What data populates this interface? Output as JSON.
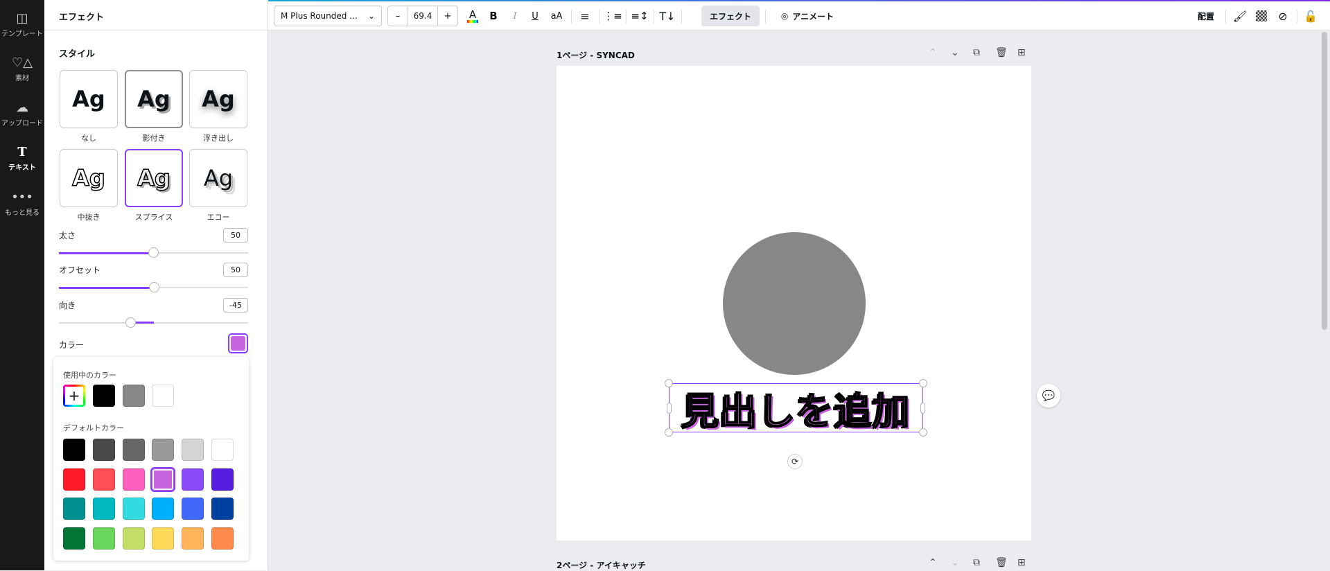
{
  "rail": [
    {
      "label": "テンプレート",
      "icon": "template-icon"
    },
    {
      "label": "素材",
      "icon": "elements-icon"
    },
    {
      "label": "アップロード",
      "icon": "upload-icon"
    },
    {
      "label": "テキスト",
      "icon": "text-icon"
    },
    {
      "label": "もっと見る",
      "icon": "more-icon"
    }
  ],
  "panel": {
    "title": "エフェクト",
    "style_title": "スタイル",
    "styles": [
      {
        "label": "なし",
        "sample": "Ag"
      },
      {
        "label": "影付き",
        "sample": "Ag"
      },
      {
        "label": "浮き出し",
        "sample": "Ag"
      },
      {
        "label": "中抜き",
        "sample": "Ag"
      },
      {
        "label": "スプライス",
        "sample": "Ag"
      },
      {
        "label": "エコー",
        "sample": "Ag"
      }
    ],
    "sliders": [
      {
        "label": "太さ",
        "value": "50",
        "percent": 50
      },
      {
        "label": "オフセット",
        "value": "50",
        "percent": 50
      },
      {
        "label": "向き",
        "value": "-45",
        "percent": 37.5
      }
    ],
    "color_label": "カラー",
    "color_value": "#c765de"
  },
  "popup": {
    "in_use_title": "使用中のカラー",
    "in_use": [
      "#000000",
      "#878787",
      "#ffffff"
    ],
    "default_title": "デフォルトカラー",
    "defaults": [
      "#000000",
      "#4a4a4a",
      "#686868",
      "#9a9a9a",
      "#d4d4d4",
      "#ffffff",
      "#ff1a28",
      "#ff4f56",
      "#ff5fbd",
      "#c765de",
      "#8c4bfa",
      "#561de0",
      "#00908f",
      "#00b8c0",
      "#32dbe0",
      "#00affc",
      "#4069fc",
      "#00419f",
      "#007535",
      "#69d55a",
      "#c3de67",
      "#ffd95a",
      "#ffb45b",
      "#ff8a4c"
    ],
    "selected_index": 9
  },
  "toolbar": {
    "font": "M Plus Rounded ...",
    "minus": "–",
    "size": "69.4",
    "plus": "+",
    "bold": "B",
    "italic": "I",
    "underline": "U",
    "case": "aA",
    "effects": "エフェクト",
    "animate": "アニメート",
    "position": "配置"
  },
  "pages": [
    {
      "title": "1ページ - SYNCAD"
    },
    {
      "title": "2ページ - アイキャッチ"
    }
  ],
  "canvas": {
    "headline": "見出しを追加",
    "circle_color": "#878787"
  }
}
